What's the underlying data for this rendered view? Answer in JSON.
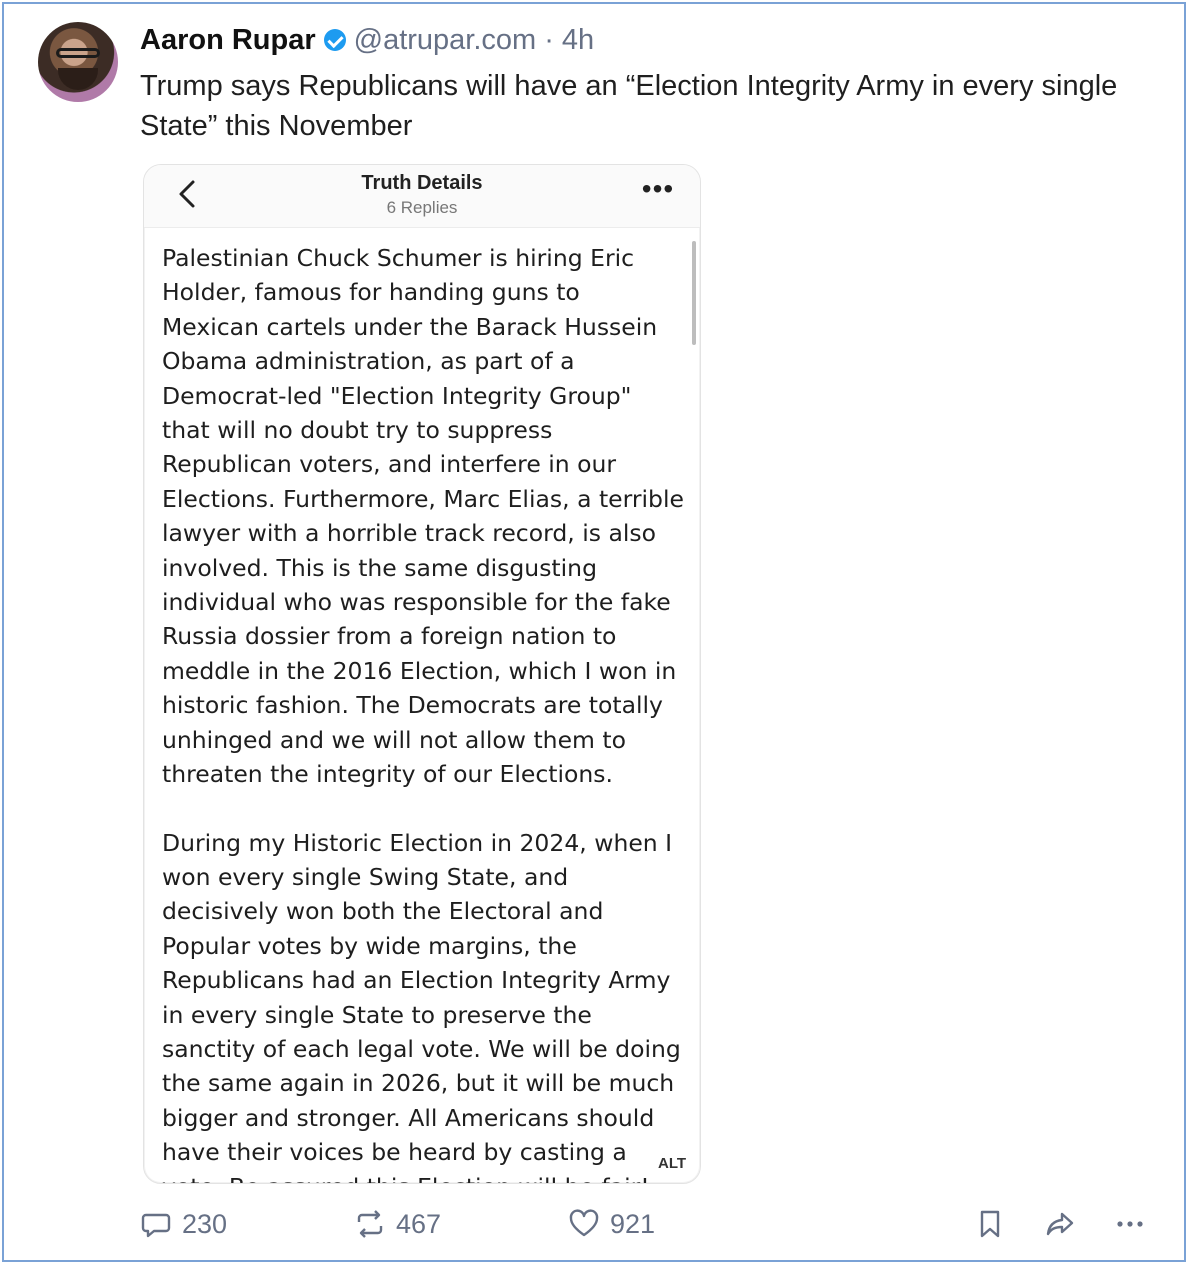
{
  "author": {
    "name": "Aaron Rupar",
    "handle": "@atrupar.com",
    "separator": "·",
    "time": "4h",
    "verified_color": "#1d9bf0"
  },
  "post_text": "Trump says Republicans will have an “Election Integrity Army in every single State” this November",
  "embed": {
    "title": "Truth Details",
    "subtitle": "6 Replies",
    "more_label": "•••",
    "paragraphs": [
      "Palestinian Chuck Schumer is hiring Eric Holder, famous for handing guns to Mexican cartels under the Barack Hussein Obama administration, as part of a Democrat-led \"Election Integrity Group\" that will no doubt try to suppress Republican voters, and interfere in our Elections. Furthermore, Marc Elias, a terrible lawyer with a horrible track record, is also involved. This is the same disgusting individual who was responsible for the fake Russia dossier from a foreign nation to meddle in the 2016 Election, which I won in historic fashion. The Democrats are totally unhinged and we will not allow them to threaten the integrity of our Elections.",
      "During my Historic Election in 2024, when I won every single Swing State, and decisively won both the Electoral and Popular votes by wide margins, the Republicans had an Election Integrity Army in every single State to preserve the sanctity of each legal vote. We will be doing the same again in 2026, but it will be much bigger and stronger. All Americans should have their voices be heard by casting a vote. Be assured this Election will be fair! President DONALD J. TRUMP"
    ],
    "alt_badge": "ALT"
  },
  "actions": {
    "replies": "230",
    "reposts": "467",
    "likes": "921"
  },
  "icons": [
    "back-icon",
    "more-icon",
    "reply-icon",
    "repost-icon",
    "like-icon",
    "bookmark-icon",
    "share-icon",
    "more-options-icon",
    "verified-icon"
  ]
}
